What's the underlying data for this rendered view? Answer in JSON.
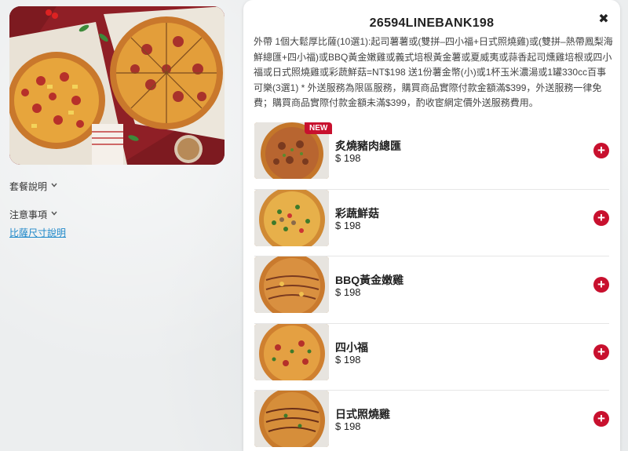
{
  "left": {
    "hero_alt": "",
    "links": [
      {
        "label": "套餐說明",
        "has_chevron": true
      },
      {
        "label": "注意事項",
        "has_chevron": true
      },
      {
        "label": "比薩尺寸說明",
        "has_chevron": false
      }
    ]
  },
  "panel": {
    "title": "26594LINEBANK198",
    "close_icon": "close-icon",
    "description": "外帶 1個大鬆厚比薩(10選1):起司薯薯或(雙拼–四小福+日式照燒雞)或(雙拼–熱帶鳳梨海鮮總匯+四小福)或BBQ黃金嫩雞或義式培根黃金薯或夏威夷或蒜香起司燻雞培根或四小福或日式照燒雞或彩蔬鮮菇=NT$198 送1份薯金幣(小)或1杯玉米濃湯或1罐330cc百事可樂(3選1) * 外送服務為限區服務，購買商品實際付款金額滿$399，外送服務一律免費；購買商品實際付款金額未滿$399，酌收宦網定價外送服務費用。",
    "items": [
      {
        "name": "炙燒豬肉總匯",
        "price": "$ 198",
        "badge": "NEW"
      },
      {
        "name": "彩蔬鮮菇",
        "price": "$ 198",
        "badge": ""
      },
      {
        "name": "BBQ黃金嫩雞",
        "price": "$ 198",
        "badge": ""
      },
      {
        "name": "四小福",
        "price": "$ 198",
        "badge": ""
      },
      {
        "name": "日式照燒雞",
        "price": "$ 198",
        "badge": ""
      }
    ],
    "add_icon": "plus-icon"
  },
  "colors": {
    "accent": "#c8102e",
    "link": "#1e88c9",
    "background": "#eceeef"
  }
}
